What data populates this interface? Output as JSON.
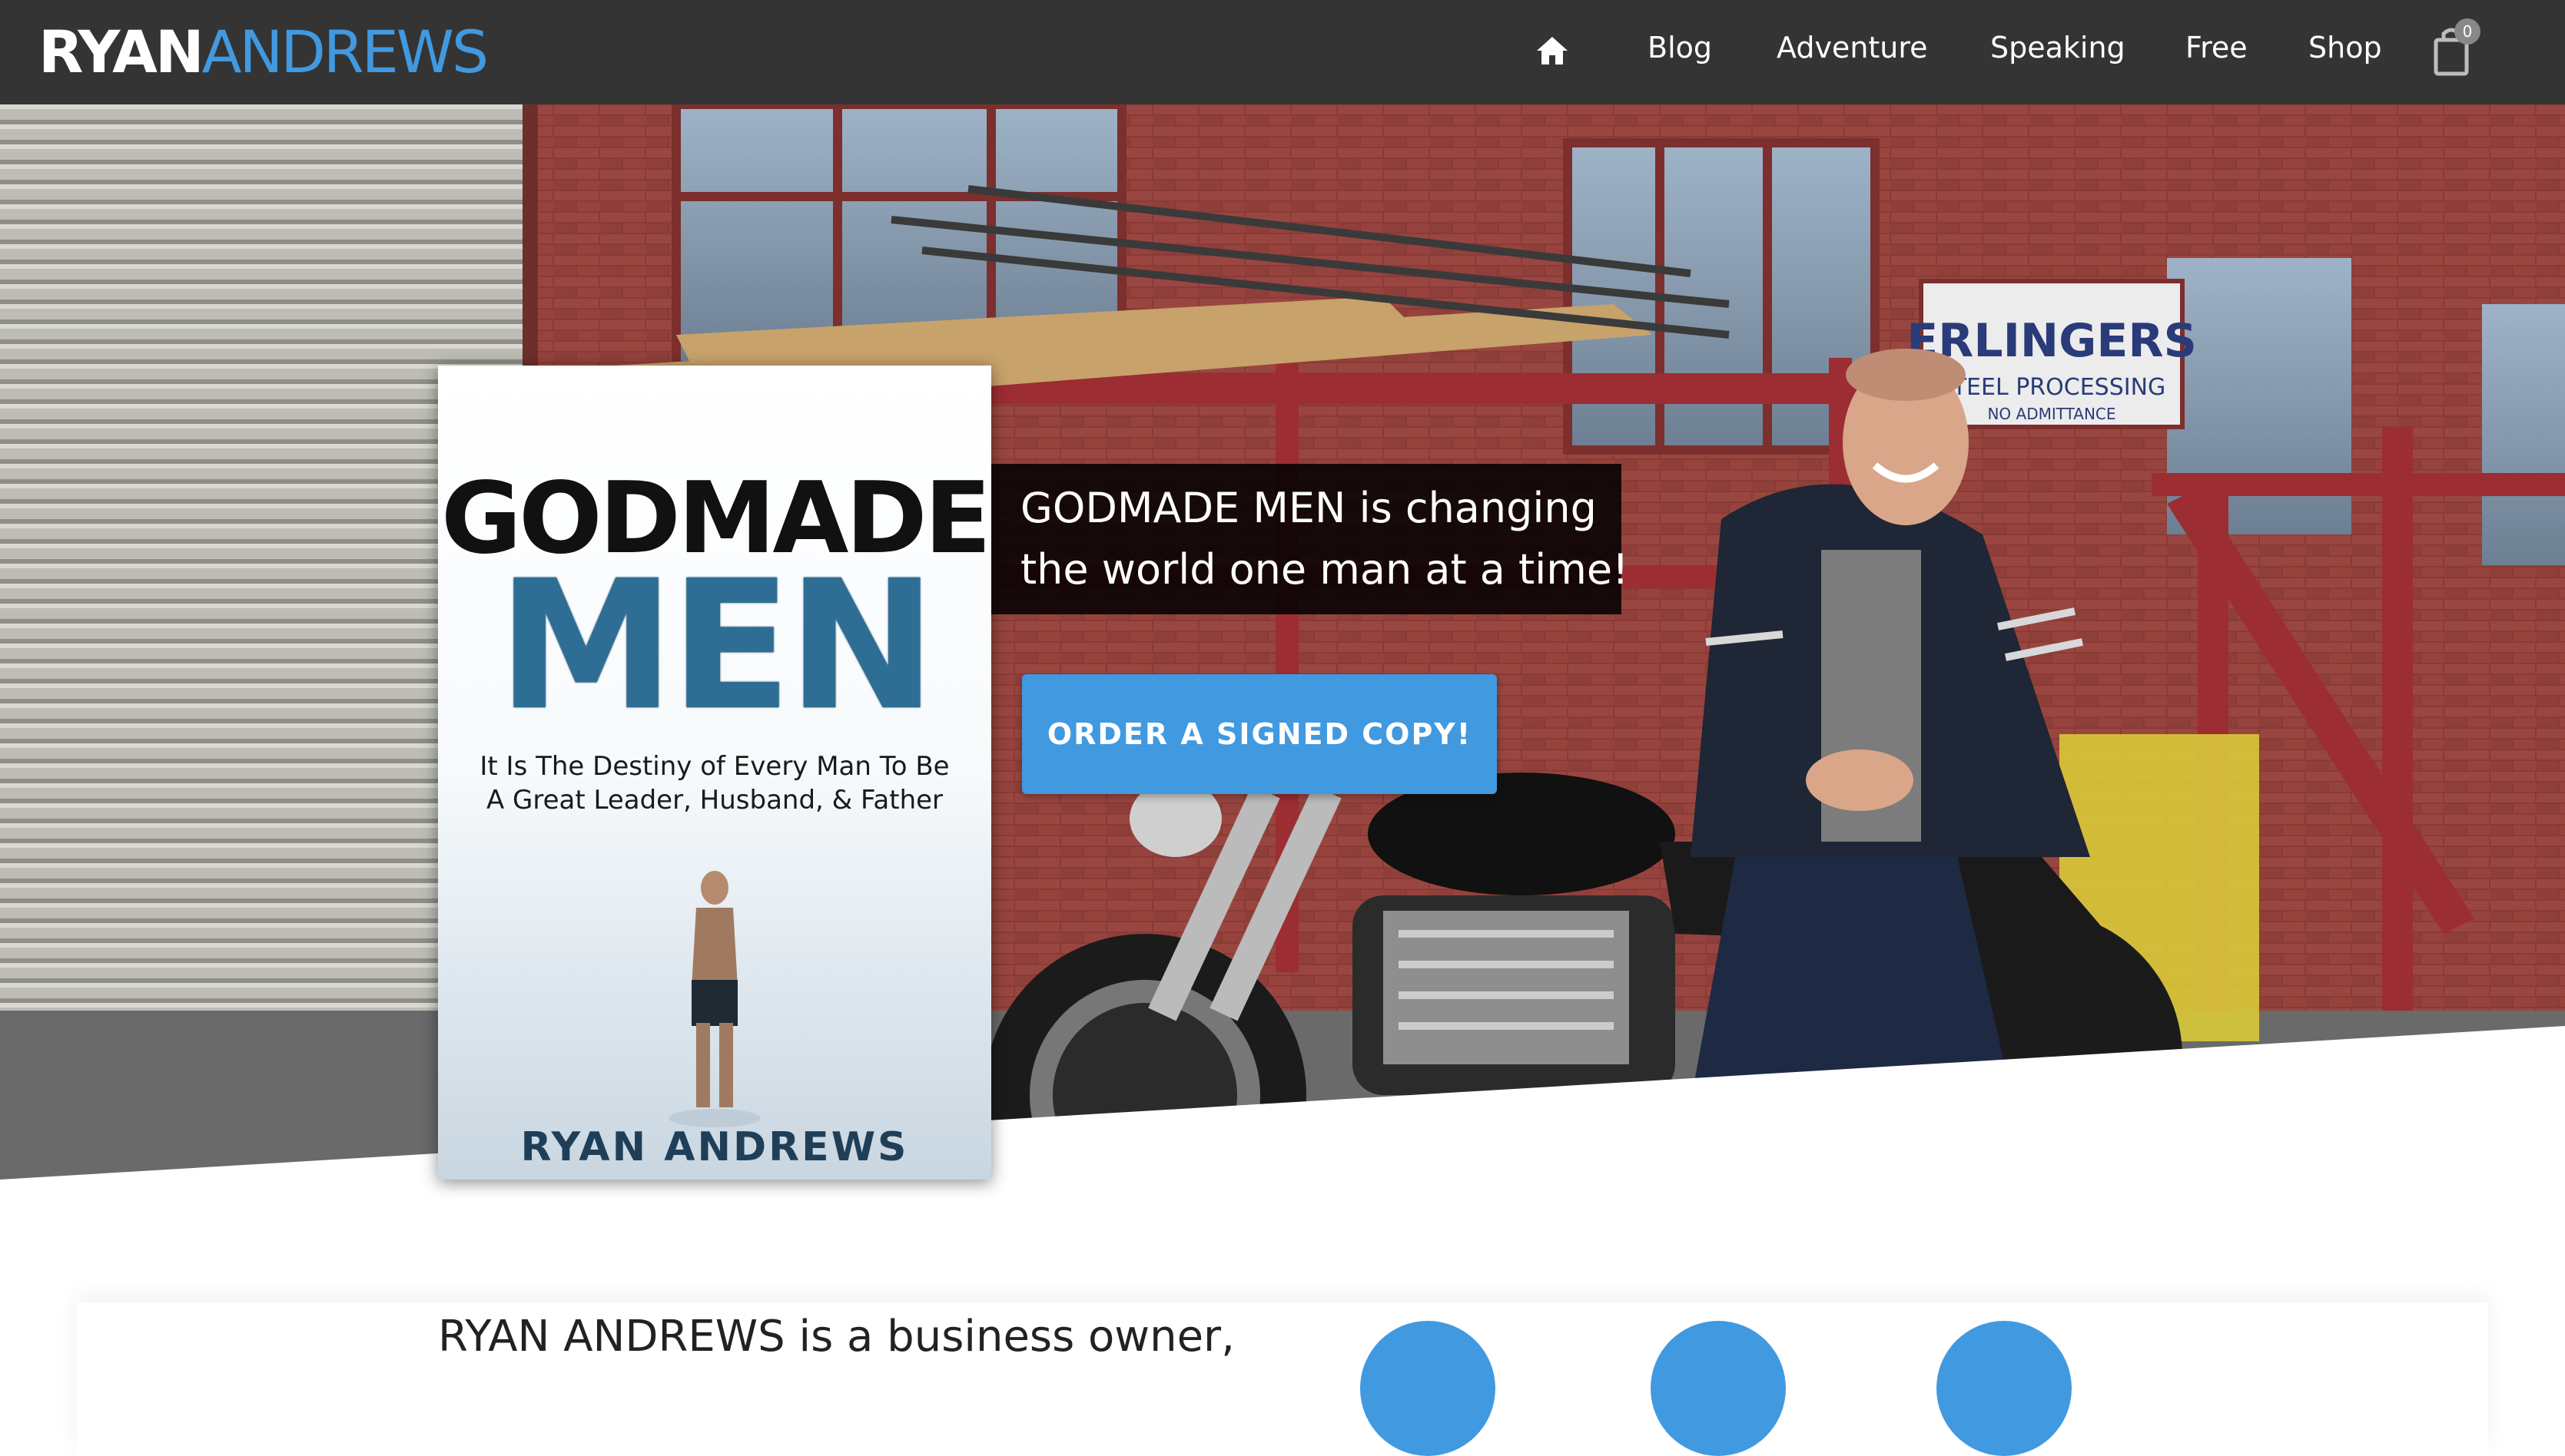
{
  "header": {
    "logo_part1": "RYAN",
    "logo_part2": "ANDREWS",
    "nav": [
      {
        "label": "Blog"
      },
      {
        "label": "Adventure"
      },
      {
        "label": "Speaking"
      },
      {
        "label": "Free"
      },
      {
        "label": "Shop"
      }
    ],
    "cart_count": "0"
  },
  "hero": {
    "book": {
      "title_line1": "GODMADE",
      "title_line2": "MEN",
      "subtitle_line1": "It Is The Destiny of Every Man To Be",
      "subtitle_line2": "A Great Leader, Husband, & Father",
      "author": "RYAN ANDREWS"
    },
    "tagline_line1": "GODMADE MEN is changing",
    "tagline_line2": "the world one man at a time!",
    "cta_label": "ORDER A SIGNED COPY!",
    "sign_text_1": "ERLINGERS",
    "sign_text_2": "STEEL PROCESSING",
    "sign_text_3": "NO ADMITTANCE"
  },
  "intro": {
    "bio_text": "RYAN ANDREWS is a business owner,"
  },
  "colors": {
    "header_bg": "#343434",
    "accent": "#4199e0",
    "brick": "#8e3b36"
  }
}
